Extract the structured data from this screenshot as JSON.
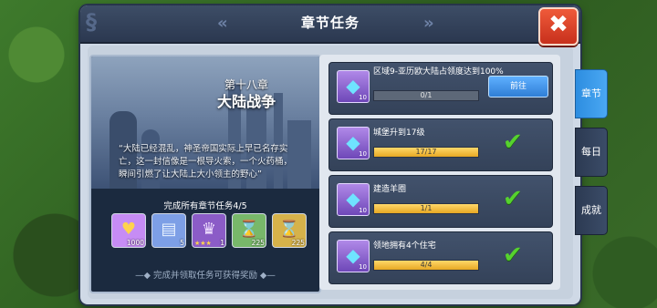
{
  "header": {
    "title": "章节任务",
    "close_icon": "close-icon"
  },
  "tabs": [
    {
      "label": "章节",
      "active": true
    },
    {
      "label": "每日",
      "active": false
    },
    {
      "label": "成就",
      "active": false
    }
  ],
  "story": {
    "chapter_number": "第十八章",
    "chapter_name": "大陆战争",
    "quote": "“大陆已经混乱，神圣帝国实际上早已名存实亡，这一封信像是一根导火索，一个火药桶，瞬间引燃了让大陆上大小领主的野心”",
    "progress_label": "完成所有章节任务4/5",
    "rewards": [
      {
        "icon": "gold-crest-icon",
        "qty": "1000",
        "color": "#c68cf5"
      },
      {
        "icon": "cards-icon",
        "qty": "5",
        "color": "#7d9fe6"
      },
      {
        "icon": "hero-portrait-icon",
        "qty": "1",
        "color": "#8b5cc7",
        "stars": "★★★"
      },
      {
        "icon": "green-hourglass-icon",
        "qty": "225",
        "color": "#78b86a"
      },
      {
        "icon": "gold-hourglass-icon",
        "qty": "225",
        "color": "#d6b24a"
      }
    ],
    "footer": "完成并领取任务可获得奖励"
  },
  "tasks": [
    {
      "text": "区域9-亚历欧大陆占领度达到100%",
      "gem_qty": "10",
      "progress": "0/1",
      "fraction": 0,
      "action": "前往",
      "done": false
    },
    {
      "text": "城堡升到17级",
      "gem_qty": "10",
      "progress": "17/17",
      "fraction": 1,
      "done": true
    },
    {
      "text": "建造羊圈",
      "gem_qty": "10",
      "progress": "1/1",
      "fraction": 1,
      "done": true
    },
    {
      "text": "领地拥有4个住宅",
      "gem_qty": "10",
      "progress": "4/4",
      "fraction": 1,
      "done": true
    }
  ],
  "colors": {
    "accent": "#2f8fe6",
    "check": "#56d22e",
    "close": "#d9381e"
  }
}
